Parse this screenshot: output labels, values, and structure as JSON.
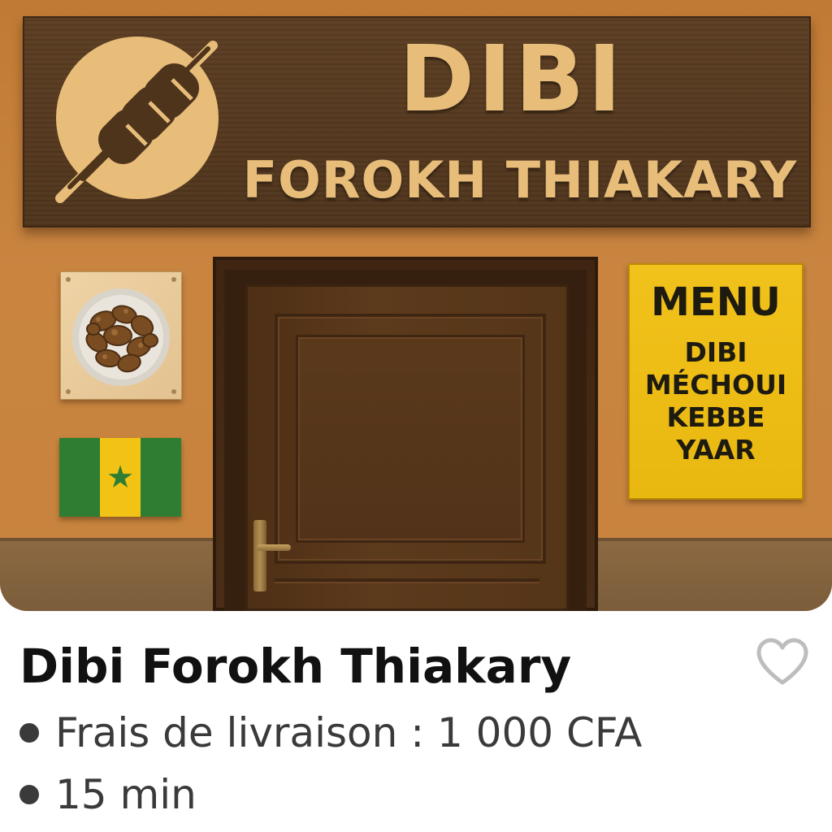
{
  "storefront": {
    "sign_title": "DIBI",
    "sign_subtitle": "FOROKH THIAKARY",
    "logo_icon": "skewer-icon",
    "menu": {
      "title": "MENU",
      "items": [
        "DIBI",
        "MÉCHOUI",
        "KEBBE",
        "YAAR"
      ]
    },
    "flag": {
      "icon": "senegal-flag-icon",
      "colors": [
        "#2e7d32",
        "#f2c314",
        "#2e7d32"
      ]
    },
    "food_image": "grilled-meat-plate-icon"
  },
  "card": {
    "name": "Dibi Forokh Thiakary",
    "delivery_fee": "Frais de livraison : 1 000 CFA",
    "delivery_time": "15 min",
    "favorite_icon": "heart-outline-icon"
  },
  "colors": {
    "sign_text": "#e7bd79",
    "menu_board": "#f1c21b",
    "text_primary": "#111111",
    "text_secondary": "#3a3a3a"
  }
}
